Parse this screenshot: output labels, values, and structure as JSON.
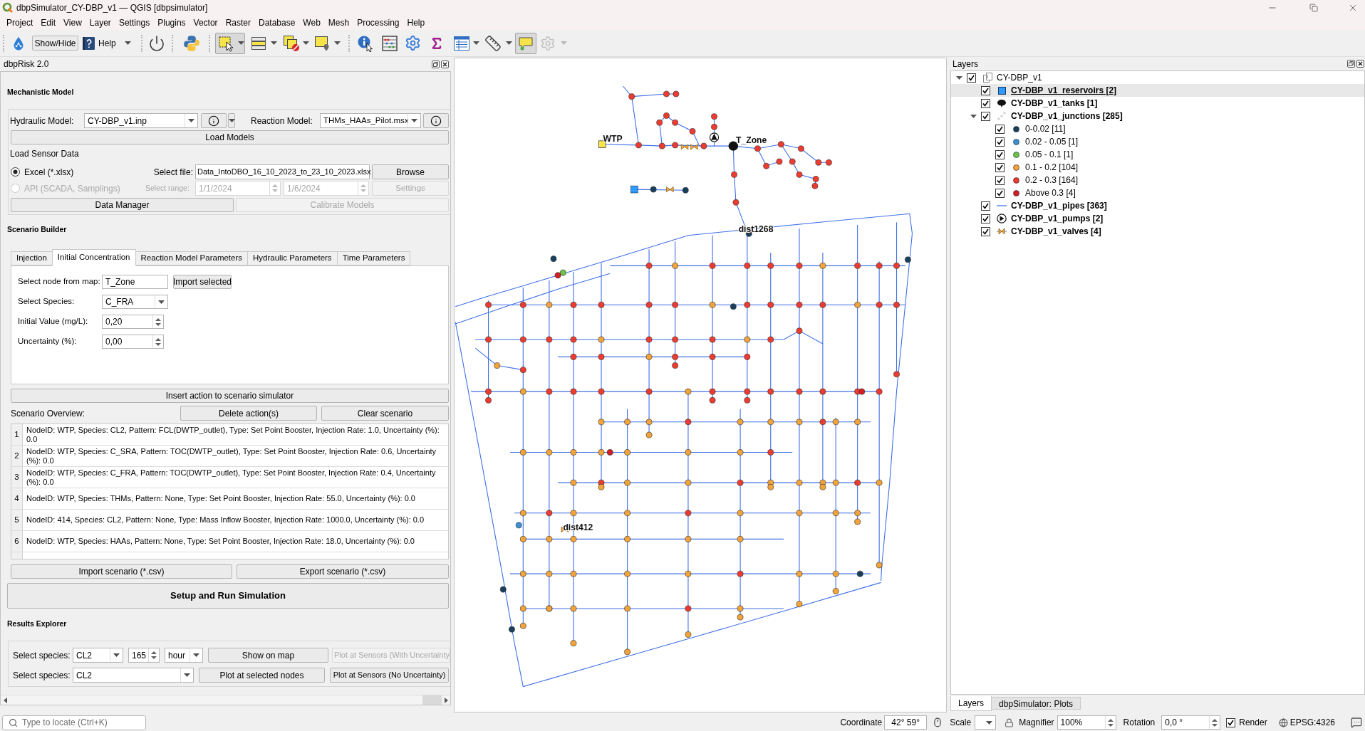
{
  "window": {
    "title": "dbpSimulator_CY-DBP_v1 — QGIS [dbpsimulator]"
  },
  "menu": [
    "Project",
    "Edit",
    "View",
    "Layer",
    "Settings",
    "Plugins",
    "Vector",
    "Raster",
    "Database",
    "Web",
    "Mesh",
    "Processing",
    "Help"
  ],
  "toolbar": {
    "show_hide_button": "Show/Hide",
    "help_button": "Help",
    "select_tool": {
      "pressed": true
    },
    "map_tips": {
      "pressed": true
    },
    "last_tool": {
      "disabled": true
    }
  },
  "dbprisk_panel": {
    "title": "dbpRisk 2.0",
    "mechanistic_model": {
      "heading": "Mechanistic Model",
      "hydraulic_model": {
        "label": "Hydraulic Model:",
        "value": "CY-DBP_v1.inp"
      },
      "reaction_model": {
        "label": "Reaction Model:",
        "value": "THMs_HAAs_Pilot.msx"
      },
      "load_models_button": "Load Models",
      "sensor_data_label": "Load Sensor Data",
      "sources": [
        {
          "label": "Excel (*.xlsx)",
          "selected": true,
          "disabled": false
        },
        {
          "label": "API (SCADA, Samplings)",
          "selected": false,
          "disabled": true
        }
      ],
      "select_file": {
        "label": "Select file:",
        "value": "Data_IntoDBO_16_10_2023_to_23_10_2023.xlsx"
      },
      "browse_button": "Browse",
      "select_range": {
        "label": "Select range:",
        "from": "1/1/2024",
        "to": "1/6/2024",
        "disabled": true
      },
      "settings_button": {
        "label": "Settings",
        "disabled": true
      },
      "data_manager_button": {
        "label": "Data Manager",
        "disabled": false
      },
      "calibrate_button": {
        "label": "Calibrate Models",
        "disabled": true
      }
    },
    "scenario_builder": {
      "heading": "Scenario Builder",
      "tabs": [
        {
          "label": "Injection",
          "selected": false
        },
        {
          "label": "Initial Concentration",
          "selected": true
        },
        {
          "label": "Reaction Model Parameters",
          "selected": false
        },
        {
          "label": "Hydraulic Parameters",
          "selected": false
        },
        {
          "label": "Time Parameters",
          "selected": false
        }
      ],
      "fields": [
        {
          "kind": "text",
          "label": "Select node from map:",
          "value": "T_Zone"
        },
        {
          "kind": "combo",
          "label": "Select Species:",
          "value": "C_FRA"
        },
        {
          "kind": "spin",
          "label": "Initial Value (mg/L):",
          "value": "0,20"
        },
        {
          "kind": "spin",
          "label": "Uncertainty (%):",
          "value": "0,00"
        }
      ],
      "import_selected_button": "Import selected",
      "insert_button": "Insert action to scenario simulator",
      "overview_label": "Scenario Overview:",
      "delete_button": "Delete action(s)",
      "clear_button": "Clear scenario",
      "actions": [
        {
          "number": "1",
          "text": "NodeID: WTP, Species: CL2, Pattern: FCL(DWTP_outlet), Type: Set Point Booster, Injection Rate: 1.0, Uncertainty (%): 0.0"
        },
        {
          "number": "2",
          "text": "NodeID: WTP, Species: C_SRA, Pattern: TOC(DWTP_outlet), Type: Set Point Booster, Injection Rate: 0.6, Uncertainty (%): 0.0"
        },
        {
          "number": "3",
          "text": "NodeID: WTP, Species: C_FRA, Pattern: TOC(DWTP_outlet), Type: Set Point Booster, Injection Rate: 0.4, Uncertainty (%): 0.0"
        },
        {
          "number": "4",
          "text": "NodeID: WTP, Species: THMs, Pattern: None, Type: Set Point Booster, Injection Rate: 55.0, Uncertainty (%): 0.0"
        },
        {
          "number": "5",
          "text": "NodeID: 414, Species: CL2, Pattern: None, Type: Mass Inflow Booster, Injection Rate: 1000.0, Uncertainty (%): 0.0"
        },
        {
          "number": "6",
          "text": "NodeID: WTP, Species: HAAs, Pattern: None, Type: Set Point Booster, Injection Rate: 18.0, Uncertainty (%): 0.0"
        }
      ],
      "import_button": "Import scenario (*.csv)",
      "export_button": "Export scenario (*.csv)"
    },
    "run_button": "Setup and Run Simulation",
    "results_explorer": {
      "heading": "Results Explorer",
      "row_1": {
        "label": "Select species:",
        "species": "CL2",
        "time": "165",
        "unit": "hour",
        "show_button": "Show on map",
        "sensors_button": {
          "label": "Plot at Sensors (With Uncertainty",
          "disabled": true
        }
      },
      "row_2": {
        "label": "Select species:",
        "species": "CL2",
        "nodes_button": "Plot at selected nodes",
        "sensors_button": {
          "label": "Plot at Sensors (No Uncertainty)",
          "disabled": false
        }
      }
    }
  },
  "map": {
    "labels": [
      "WTP",
      "T_Zone",
      "dist1268",
      "dist412"
    ]
  },
  "layers_panel": {
    "title": "Layers",
    "tree": [
      {
        "label": "CY-DBP_v1",
        "kind": "group",
        "checked": true,
        "expanded": true,
        "selected": false,
        "children": [
          {
            "label": "CY-DBP_v1_reservoirs [2]",
            "kind": "reservoir",
            "checked": true,
            "selected": true
          },
          {
            "label": "CY-DBP_v1_tanks [1]",
            "kind": "tank",
            "checked": true,
            "selected": false
          },
          {
            "label": "CY-DBP_v1_junctions [285]",
            "kind": "junctions",
            "checked": true,
            "expanded": true,
            "selected": false,
            "children": [
              {
                "label": "0-0.02 [11]",
                "kind": "class",
                "color": "#183f5c",
                "checked": true,
                "selected": false
              },
              {
                "label": "0.02 - 0.05 [1]",
                "kind": "class",
                "color": "#3b8fd3",
                "checked": true,
                "selected": false
              },
              {
                "label": "0.05 - 0.1 [1]",
                "kind": "class",
                "color": "#6cc24a",
                "checked": true,
                "selected": false
              },
              {
                "label": "0.1 - 0.2 [104]",
                "kind": "class",
                "color": "#f2a33a",
                "checked": true,
                "selected": false
              },
              {
                "label": "0.2 - 0.3 [164]",
                "kind": "class",
                "color": "#ee3b30",
                "checked": true,
                "selected": false
              },
              {
                "label": "Above 0.3 [4]",
                "kind": "class",
                "color": "#d11f23",
                "checked": true,
                "selected": false
              }
            ]
          },
          {
            "label": "CY-DBP_v1_pipes [363]",
            "kind": "pipe",
            "checked": true,
            "selected": false
          },
          {
            "label": "CY-DBP_v1_pumps [2]",
            "kind": "pump",
            "checked": true,
            "selected": false
          },
          {
            "label": "CY-DBP_v1_valves [4]",
            "kind": "valve",
            "checked": true,
            "selected": false
          }
        ]
      }
    ],
    "tabs": [
      {
        "label": "Layers",
        "selected": true
      },
      {
        "label": "dbpSimulator: Plots",
        "selected": false
      }
    ]
  },
  "status_bar": {
    "locate": {
      "placeholder": "Type to locate (Ctrl+K)"
    },
    "coordinate": {
      "label": "Coordinate",
      "value": "42° 59°"
    },
    "scale": {
      "label": "Scale"
    },
    "magnifier": {
      "label": "Magnifier",
      "value": "100%"
    },
    "rotation": {
      "label": "Rotation",
      "value": "0,0 °"
    },
    "render": {
      "label": "Render",
      "checked": true
    },
    "crs": "EPSG:4326"
  }
}
